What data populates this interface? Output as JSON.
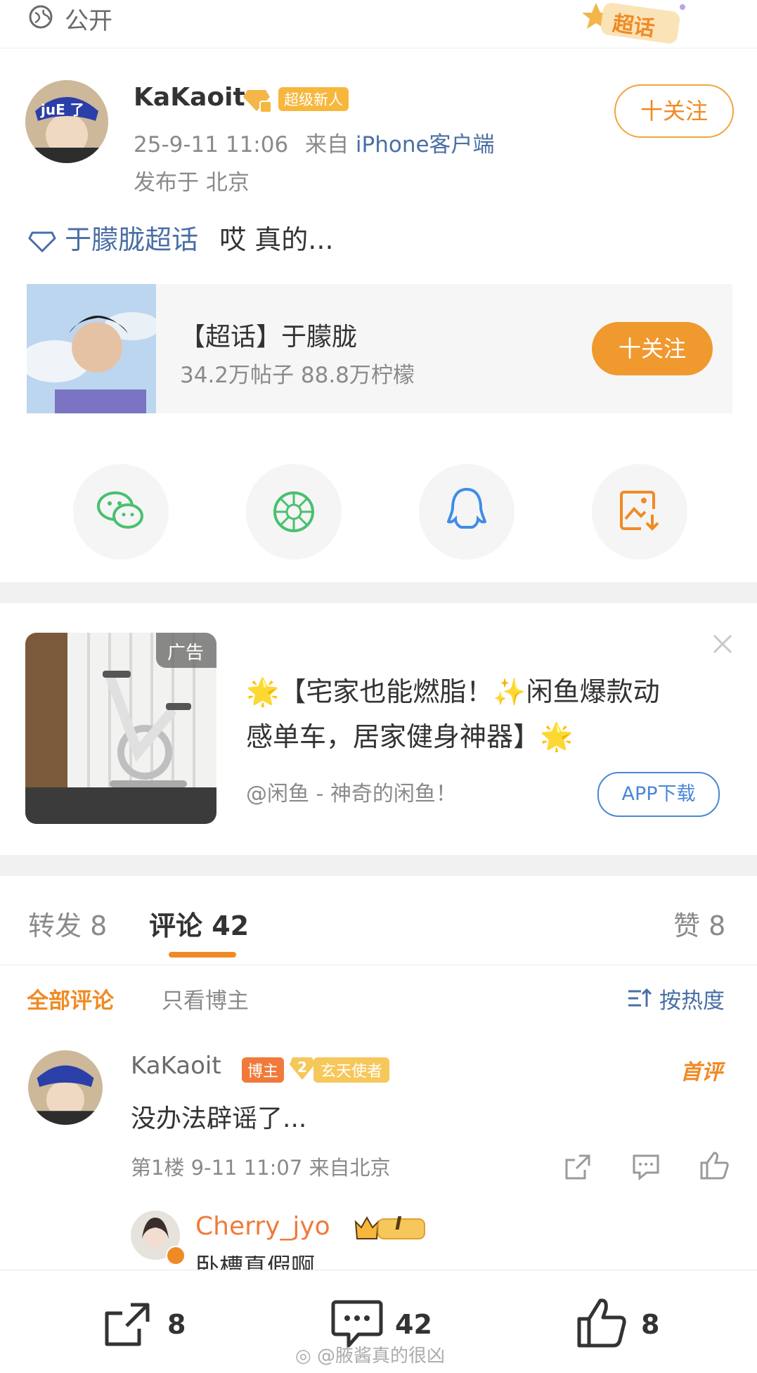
{
  "top": {
    "visibility": "公开",
    "chaohua_tag": "超话"
  },
  "post": {
    "author": "KaKaoit",
    "author_badge": "超级新人",
    "datetime": "25-9-11 11:06",
    "source_prefix": "来自",
    "source": "iPhone客户端",
    "location": "发布于 北京",
    "topic": "于朦胧超话",
    "text": "哎 真的...",
    "follow_label": "十关注",
    "avatar_cap_text": "juE 了"
  },
  "supertopic_card": {
    "title": "【超话】于朦胧",
    "stats": "34.2万帖子  88.8万柠檬",
    "follow_label": "十关注"
  },
  "share": {
    "icons": [
      "wechat-icon",
      "moments-icon",
      "qq-icon",
      "save-image-icon"
    ]
  },
  "ad": {
    "tag": "广告",
    "line1": "【宅家也能燃脂！",
    "line1b": "闲鱼爆款动",
    "line2": "感单车，居家健身神器】",
    "source": "@闲鱼 - 神奇的闲鱼！",
    "button": "APP下载"
  },
  "tabs": {
    "repost": "转发 8",
    "comments": "评论 42",
    "likes": "赞 8"
  },
  "filters": {
    "all": "全部评论",
    "author_only": "只看博主",
    "sort": "按热度"
  },
  "comment": {
    "author": "KaKaoit",
    "role_badge": "博主",
    "level_badge": "玄天使者",
    "level_num": "2",
    "first_tag": "首评",
    "text": "没办法辟谣了...",
    "meta": "第1楼  9-11 11:07  来自北京"
  },
  "reply": {
    "author": "Cherry_jyo",
    "level_text": "I",
    "text_partial": "卧槽真假啊"
  },
  "bottom": {
    "repost_count": "8",
    "comment_count": "42",
    "like_count": "8",
    "watermark": "@腋酱真的很凶"
  },
  "colors": {
    "accent": "#f08a24",
    "link": "#4a6fa5",
    "badge": "#f6b73c"
  }
}
